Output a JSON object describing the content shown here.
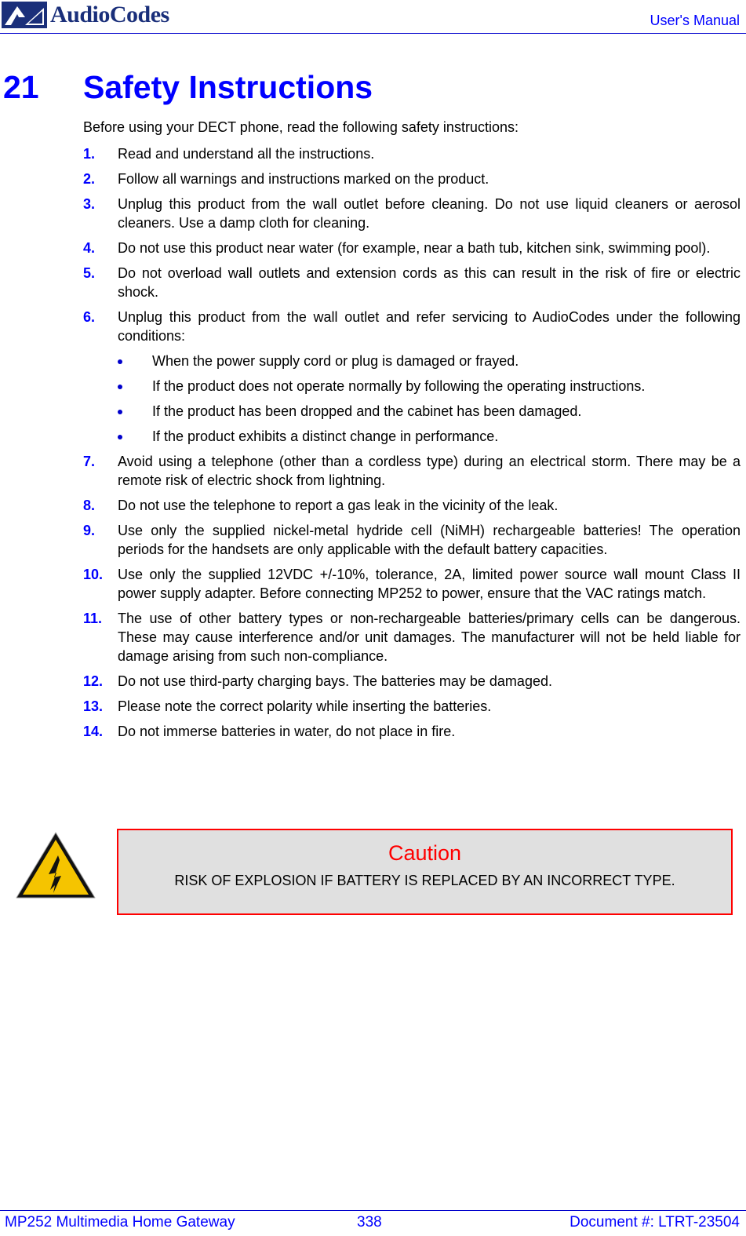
{
  "header": {
    "brand": "AudioCodes",
    "doc_type": "User's Manual",
    "logo_icon": "audiocodes-logo-icon"
  },
  "chapter": {
    "number": "21",
    "title": "Safety Instructions"
  },
  "intro": "Before using your DECT phone, read the following safety instructions:",
  "items": [
    {
      "num": "1.",
      "text": "Read and understand all the instructions."
    },
    {
      "num": "2.",
      "text": "Follow all warnings and instructions marked on the product."
    },
    {
      "num": "3.",
      "text": "Unplug this product from the wall outlet before cleaning. Do not use liquid cleaners or aerosol cleaners. Use a damp cloth for cleaning."
    },
    {
      "num": "4.",
      "text": "Do not use this product near water (for example, near a bath tub, kitchen sink, swimming pool)."
    },
    {
      "num": "5.",
      "text": "Do not overload wall outlets and extension cords as this can result in the risk of fire or electric shock."
    },
    {
      "num": "6.",
      "text": "Unplug this product from the wall outlet and refer servicing to AudioCodes under the following conditions:",
      "bullets": [
        "When the power supply cord or plug is damaged or frayed.",
        "If the product does not operate normally by following the operating instructions.",
        "If the product has been dropped and the cabinet has been damaged.",
        "If the product exhibits a distinct change in performance."
      ]
    },
    {
      "num": "7.",
      "text": "Avoid using a telephone (other than a cordless type) during an electrical storm. There may be a remote risk of electric shock from lightning."
    },
    {
      "num": "8.",
      "text": "Do not use the telephone to report a gas leak in the vicinity of the leak."
    },
    {
      "num": "9.",
      "text": "Use only the supplied nickel-metal hydride cell (NiMH) rechargeable batteries! The operation periods for the handsets are only applicable with the default battery capacities."
    },
    {
      "num": "10.",
      "text": "Use only the supplied 12VDC +/-10%, tolerance, 2A, limited power source wall mount Class II power supply adapter. Before connecting MP252 to power, ensure that the VAC ratings match."
    },
    {
      "num": "11.",
      "text": "The use of other battery types or non-rechargeable batteries/primary cells can be dangerous. These may cause interference and/or unit damages. The manufacturer will not be held liable for damage arising from such non-compliance."
    },
    {
      "num": "12.",
      "text": "Do not use third-party charging bays. The batteries may be damaged."
    },
    {
      "num": "13.",
      "text": "Please note the correct polarity while inserting the batteries."
    },
    {
      "num": "14.",
      "text": "Do not immerse batteries in water, do not place in fire."
    }
  ],
  "caution": {
    "icon": "high-voltage-warning-icon",
    "title": "Caution",
    "text": "RISK OF EXPLOSION IF BATTERY IS REPLACED BY AN INCORRECT TYPE."
  },
  "footer": {
    "product": "MP252 Multimedia Home Gateway",
    "page": "338",
    "document": "Document #: LTRT-23504"
  },
  "colors": {
    "accent_blue": "#0000ff",
    "caution_red": "#ff0000",
    "caution_bg": "#e0e0e0",
    "warning_yellow": "#f5c400"
  }
}
